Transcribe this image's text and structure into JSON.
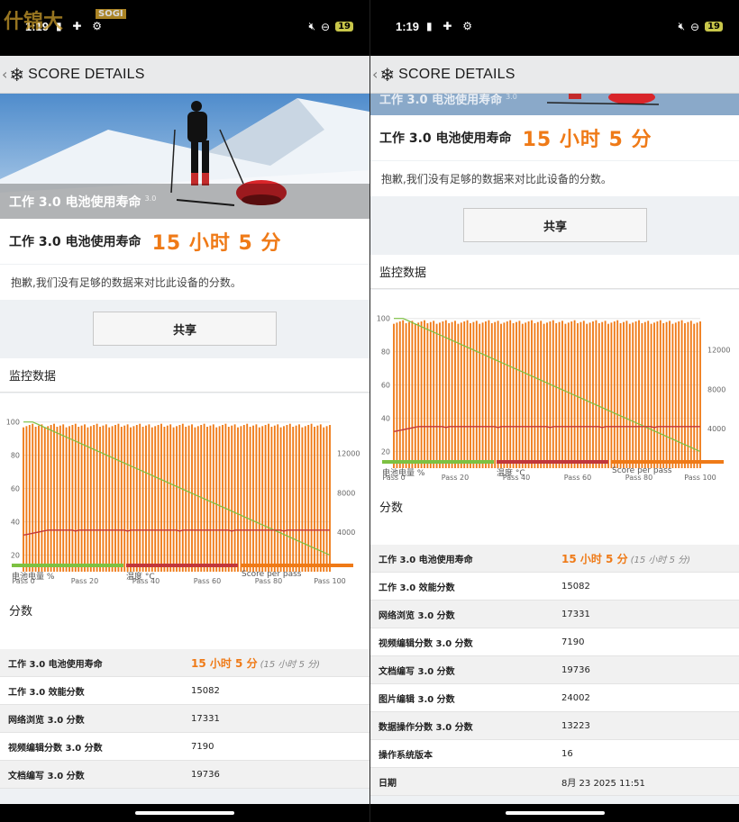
{
  "status": {
    "time": "1:19",
    "battery": "19"
  },
  "appbar": {
    "title": "SCORE DETAILS"
  },
  "watermark": {
    "text": "什锦大",
    "badge": "SOGI"
  },
  "hero": {
    "label": "工作 3.0 电池使用寿命",
    "version": "3.0"
  },
  "score": {
    "name": "工作 3.0 电池使用寿命",
    "value": "15 小时 5 分"
  },
  "sorry_text": "抱歉,我们没有足够的数据来对比此设备的分数。",
  "share_label": "共享",
  "monitor_title": "监控数据",
  "scores_title": "分数",
  "legend": [
    {
      "label": "电池电量 %",
      "color": "#7dc142"
    },
    {
      "label": "温度 °C",
      "color": "#c1373b"
    },
    {
      "label": "Score per pass",
      "color": "#ef7a17"
    }
  ],
  "chart_data": {
    "type": "bar",
    "x_ticks": [
      "Pass 0",
      "Pass 20",
      "Pass 40",
      "Pass 60",
      "Pass 80",
      "Pass 100"
    ],
    "y_left_ticks": [
      "100",
      "80",
      "60",
      "40",
      "20"
    ],
    "y_right_ticks": [
      "12000",
      "8000",
      "4000"
    ],
    "ylim_left": [
      10,
      102
    ],
    "ylim_right": [
      0,
      15500
    ],
    "passes": 101,
    "series": [
      {
        "name": "Score per pass",
        "axis": "right",
        "color": "#ef7a17",
        "value_approx": 14800
      },
      {
        "name": "电池电量 %",
        "axis": "left",
        "color": "#7dc142",
        "start": 100,
        "end": 20
      },
      {
        "name": "温度 °C",
        "axis": "left",
        "color": "#c1373b",
        "start": 32,
        "plateau": 35
      }
    ]
  },
  "scores": [
    {
      "key": "工作 3.0 电池使用寿命",
      "value": "15 小时 5 分",
      "sub": "(15 小时 5 分)",
      "highlight": true
    },
    {
      "key": "工作 3.0 效能分数",
      "value": "15082"
    },
    {
      "key": "网络浏览 3.0 分数",
      "value": "17331"
    },
    {
      "key": "视频编辑分数 3.0 分数",
      "value": "7190"
    },
    {
      "key": "文档编写 3.0 分数",
      "value": "19736"
    },
    {
      "key": "图片编辑 3.0 分数",
      "value": "24002"
    },
    {
      "key": "数据操作分数 3.0 分数",
      "value": "13223"
    },
    {
      "key": "操作系统版本",
      "value": "16"
    },
    {
      "key": "日期",
      "value": "8月 23 2025 11:51"
    }
  ]
}
